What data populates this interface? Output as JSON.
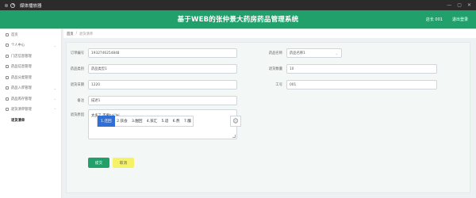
{
  "window": {
    "title": "媒体播放器",
    "controls": {
      "minimize": "—",
      "maximize": "▢",
      "close": "✕"
    }
  },
  "header": {
    "title": "基于WEB的张仲景大药房药品管理系统",
    "user": "店长 001",
    "logout": "退出登录"
  },
  "sidebar": {
    "items": [
      {
        "label": "首页",
        "icon": "home-icon"
      },
      {
        "label": "个人中心",
        "icon": "user-icon"
      },
      {
        "label": "门店信息管理",
        "icon": "store-icon"
      },
      {
        "label": "药品信息管理",
        "icon": "pill-icon"
      },
      {
        "label": "药品分类管理",
        "icon": "category-icon"
      },
      {
        "label": "药品入库管理",
        "icon": "inbound-icon"
      },
      {
        "label": "药品库存管理",
        "icon": "stock-icon"
      },
      {
        "label": "退货清单管理",
        "icon": "return-icon"
      },
      {
        "label": "退货清单",
        "icon": ""
      }
    ]
  },
  "breadcrumb": {
    "home": "首页",
    "sep": "/",
    "current": "退货清单"
  },
  "form": {
    "order_no": {
      "label": "订单编号",
      "value": "1932746254848"
    },
    "drug_name_sel": {
      "label": "药品名称",
      "value": "药品名称1"
    },
    "drug_name": {
      "label": "药品类别",
      "value": "药品类型1"
    },
    "return_qty": {
      "label": "退货数量",
      "value": "10"
    },
    "return_date": {
      "label": "退货日期",
      "value": "1220"
    },
    "staff_no": {
      "label": "工号",
      "value": "001"
    },
    "remark": {
      "label": "备注",
      "value": "描述1"
    },
    "reason": {
      "label": "退货原因",
      "value": "太多了 不要hai'lei"
    }
  },
  "ime": {
    "candidates": [
      "1.还回",
      "2.孩会",
      "3.酣回",
      "4.孩汇",
      "5.适",
      "6.熬",
      "7.醜"
    ],
    "more": "☺"
  },
  "buttons": {
    "submit": "提交",
    "cancel": "取消"
  }
}
